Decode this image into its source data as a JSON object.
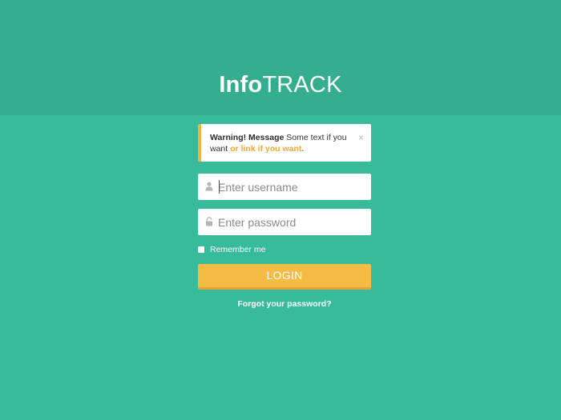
{
  "brand": {
    "name_bold": "Info",
    "name_light": "TRACK"
  },
  "alert": {
    "strong": "Warning! Message",
    "text": " Some text if you want ",
    "link": "or link if you want",
    "suffix": ".",
    "close_icon": "×"
  },
  "form": {
    "username_placeholder": "Enter username",
    "password_placeholder": "Enter password",
    "remember_label": "Remember me",
    "login_label": "LOGIN",
    "forgot_label": "Forgot your password?"
  },
  "icons": {
    "username": "user-icon",
    "password": "lock-icon"
  },
  "colors": {
    "background": "#37bb9b",
    "header": "#34ae8f",
    "accent": "#f4bc44",
    "alert_border": "#f3b33f",
    "link": "#f3a833"
  }
}
